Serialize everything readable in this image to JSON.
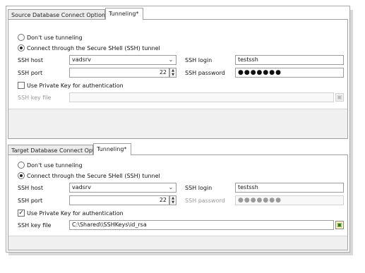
{
  "source": {
    "tab_options": "Source Database Connect Options",
    "tab_tunneling": "Tunneling*",
    "radio_none": "Don't use tunneling",
    "radio_ssh": "Connect through the Secure SHell (SSH) tunnel",
    "ssh_host_label": "SSH host",
    "ssh_host_value": "vadsrv",
    "ssh_port_label": "SSH port",
    "ssh_port_value": "22",
    "ssh_login_label": "SSH login",
    "ssh_login_value": "testssh",
    "ssh_password_label": "SSH password",
    "ssh_password_value": "●●●●●●●",
    "private_key_label": "Use Private Key for authentication",
    "private_key_checked": false,
    "ssh_key_file_label": "SSH key file",
    "ssh_key_file_value": ""
  },
  "target": {
    "tab_options": "Target Database Connect Options",
    "tab_tunneling": "Tunneling*",
    "radio_none": "Don't use tunneling",
    "radio_ssh": "Connect through the Secure SHell (SSH) tunnel",
    "ssh_host_label": "SSH host",
    "ssh_host_value": "vadsrv",
    "ssh_port_label": "SSH port",
    "ssh_port_value": "22",
    "ssh_login_label": "SSH login",
    "ssh_login_value": "testssh",
    "ssh_password_label": "SSH password",
    "ssh_password_value": "●●●●●●●",
    "private_key_label": "Use Private Key for authentication",
    "private_key_checked": true,
    "ssh_key_file_label": "SSH key file",
    "ssh_key_file_value": "C:\\Shared\\\\SSHKeys\\id_rsa"
  },
  "icons": {
    "combo": "chevron-down-icon",
    "spin": "spin-arrows-icon",
    "browse": "folder-open-icon",
    "check": "✓"
  }
}
